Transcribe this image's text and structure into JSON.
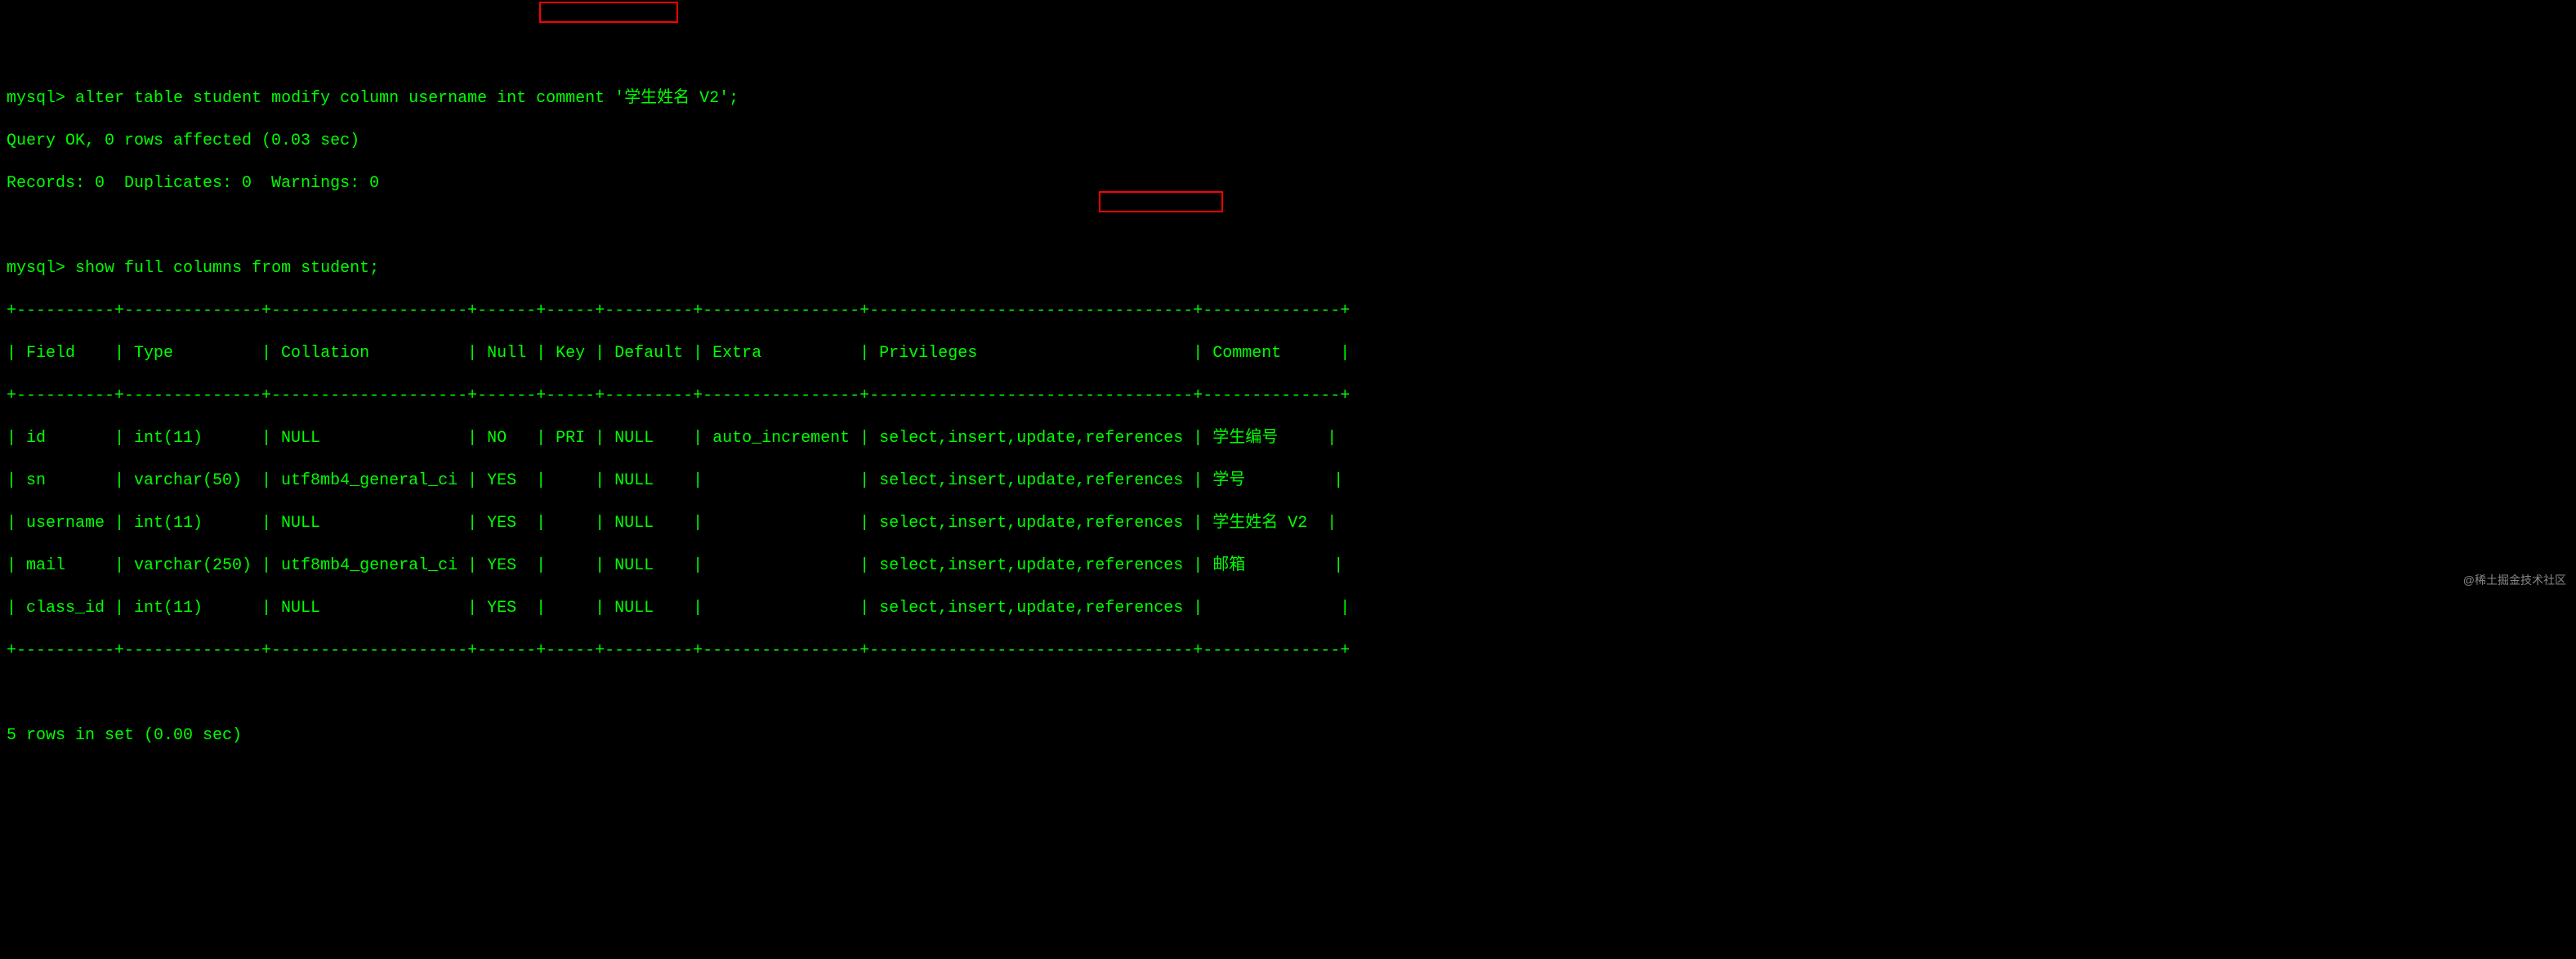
{
  "prompt": "mysql>",
  "command1": "alter table student modify column username int comment ",
  "command1_highlight": "'学生姓名 V2'",
  "command1_end": ";",
  "result1_line1": "Query OK, 0 rows affected (0.03 sec)",
  "result1_line2": "Records: 0  Duplicates: 0  Warnings: 0",
  "command2": "show full columns from student;",
  "table": {
    "border_top": "+----------+--------------+--------------------+------+-----+---------+----------------+---------------------------------+--------------+",
    "header": "| Field    | Type         | Collation          | Null | Key | Default | Extra          | Privileges                      | Comment      |",
    "border_mid": "+----------+--------------+--------------------+------+-----+---------+----------------+---------------------------------+--------------+",
    "row1": "| id       | int(11)      | NULL               | NO   | PRI | NULL    | auto_increment | select,insert,update,references | 学生编号     |",
    "row2": "| sn       | varchar(50)  | utf8mb4_general_ci | YES  |     | NULL    |                | select,insert,update,references | 学号         |",
    "row3_a": "| username | int(11)      | NULL               | YES  |     | NULL    |                | select,insert,update,references | ",
    "row3_highlight": "学生姓名 V2",
    "row3_b": "  |",
    "row4": "| mail     | varchar(250) | utf8mb4_general_ci | YES  |     | NULL    |                | select,insert,update,references | 邮箱         |",
    "row5": "| class_id | int(11)      | NULL               | YES  |     | NULL    |                | select,insert,update,references |              |",
    "border_bot": "+----------+--------------+--------------------+------+-----+---------+----------------+---------------------------------+--------------+"
  },
  "result2": "5 rows in set (0.00 sec)",
  "watermark": "@稀土掘金技术社区"
}
